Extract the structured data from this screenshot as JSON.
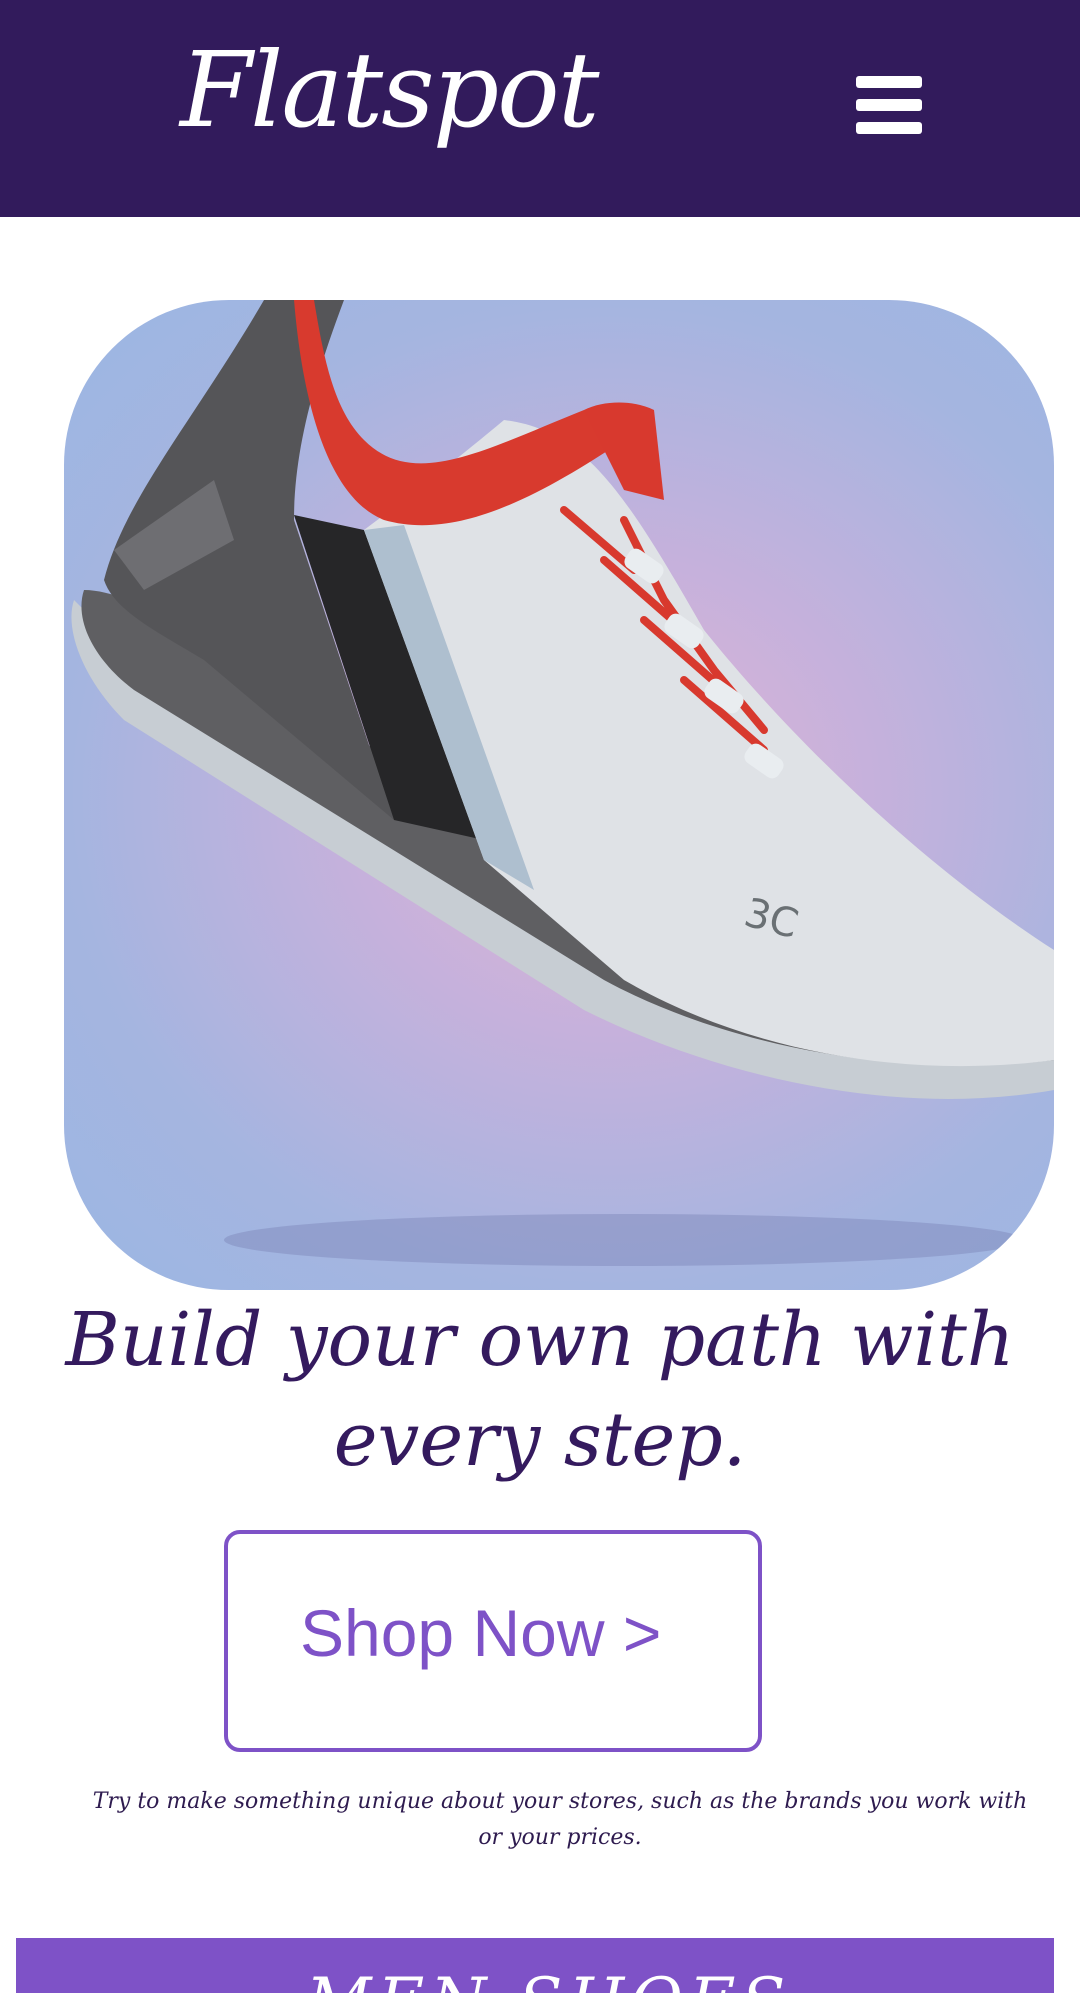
{
  "header": {
    "logo_text": "Flatspot",
    "menu_icon": "hamburger-menu-icon",
    "background_color": "#321b5c"
  },
  "hero": {
    "image": "sneaker-product-image",
    "image_badge_text": "3C"
  },
  "main": {
    "headline": "Build your own path with every step.",
    "cta_label": "Shop Now >",
    "tagline": "Try to make something unique about your stores, such as the brands you work with or your prices."
  },
  "bottom_banner": {
    "text": "MEN SHOES",
    "background_color": "#7e52c7"
  },
  "colors": {
    "accent": "#7e52c7",
    "heading": "#341a5e",
    "header_bg": "#321b5c"
  }
}
